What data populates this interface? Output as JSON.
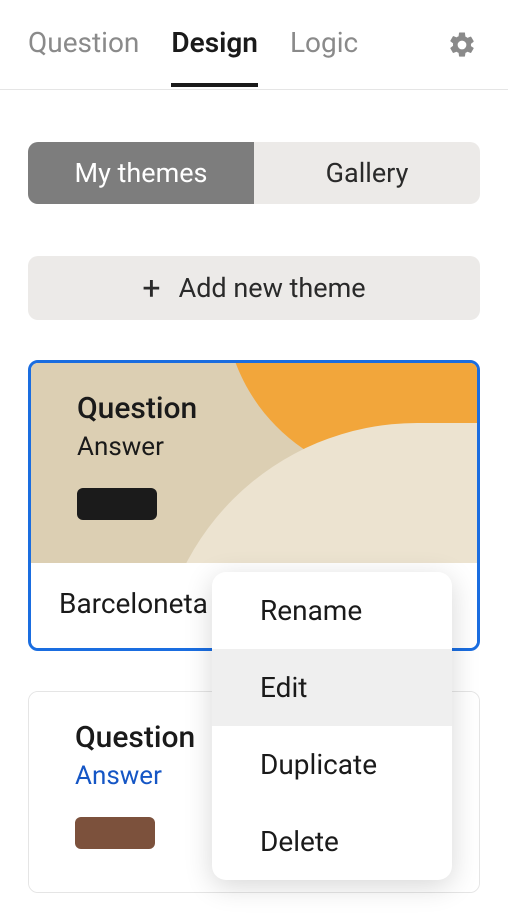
{
  "tabs": {
    "items": [
      {
        "label": "Question"
      },
      {
        "label": "Design"
      },
      {
        "label": "Logic"
      }
    ],
    "active_index": 1
  },
  "segmented": {
    "items": [
      {
        "label": "My themes"
      },
      {
        "label": "Gallery"
      }
    ],
    "active_index": 0
  },
  "add_theme_label": "Add new theme",
  "preview_text": {
    "question": "Question",
    "answer": "Answer"
  },
  "themes": [
    {
      "name": "Barceloneta",
      "selected": true,
      "background": "#dccfb3",
      "answer_color": "#1a1a1a",
      "swatch_color": "#1b1b1b"
    },
    {
      "name": "",
      "selected": false,
      "background": "#ffffff",
      "answer_color": "#1556c5",
      "swatch_color": "#7c513c"
    }
  ],
  "context_menu": {
    "items": [
      {
        "label": "Rename"
      },
      {
        "label": "Edit"
      },
      {
        "label": "Duplicate"
      },
      {
        "label": "Delete"
      }
    ],
    "hover_index": 1
  }
}
